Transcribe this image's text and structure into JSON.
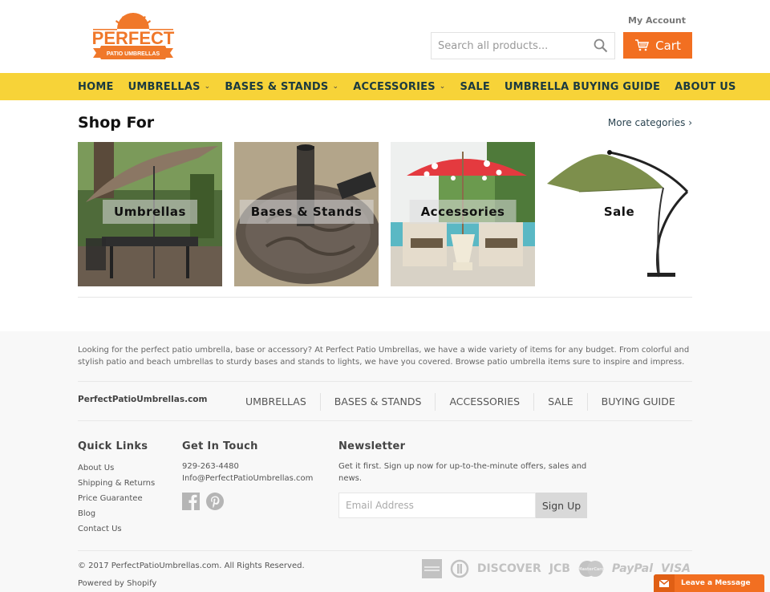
{
  "header": {
    "logo_text": "PERFECT",
    "logo_subtext": "PATIO UMBRELLAS",
    "my_account": "My Account",
    "search_placeholder": "Search all products...",
    "cart_label": "Cart"
  },
  "nav": {
    "items": [
      {
        "label": "HOME",
        "dropdown": false
      },
      {
        "label": "UMBRELLAS",
        "dropdown": true
      },
      {
        "label": "BASES & STANDS",
        "dropdown": true
      },
      {
        "label": "ACCESSORIES",
        "dropdown": true
      },
      {
        "label": "SALE",
        "dropdown": false
      },
      {
        "label": "UMBRELLA BUYING GUIDE",
        "dropdown": false
      },
      {
        "label": "ABOUT US",
        "dropdown": false
      }
    ],
    "chevron": "⌄"
  },
  "shop": {
    "title": "Shop For",
    "more_link": "More categories ›",
    "tiles": [
      {
        "label": "Umbrellas"
      },
      {
        "label": "Bases & Stands"
      },
      {
        "label": "Accessories"
      },
      {
        "label": "Sale"
      }
    ]
  },
  "footer": {
    "about": "Looking for the perfect patio umbrella, base or accessory? At Perfect Patio Umbrellas, we have a wide variety of items for any budget. From colorful and stylish patio and beach umbrellas to sturdy bases and stands to lights, we have you covered. Browse patio umbrella items sure to inspire and impress.",
    "site_name": "PerfectPatioUmbrellas.com",
    "links": [
      "UMBRELLAS",
      "BASES & STANDS",
      "ACCESSORIES",
      "SALE",
      "BUYING GUIDE"
    ],
    "quick_links": {
      "title": "Quick Links",
      "items": [
        "About Us",
        "Shipping & Returns",
        "Price Guarantee",
        "Blog",
        "Contact Us"
      ]
    },
    "get_in_touch": {
      "title": "Get In Touch",
      "phone": "929-263-4480",
      "email": "Info@PerfectPatioUmbrellas.com"
    },
    "newsletter": {
      "title": "Newsletter",
      "text": "Get it first. Sign up now for up-to-the-minute offers, sales and news.",
      "placeholder": "Email Address",
      "button": "Sign Up"
    },
    "copyright": "© 2017 PerfectPatioUmbrellas.com. All Rights Reserved.",
    "powered": "Powered by Shopify",
    "payments": [
      "American Express",
      "Diners Club",
      "DISCOVER",
      "JCB",
      "MasterCard",
      "PayPal",
      "VISA"
    ]
  },
  "chat": {
    "label": "Leave a Message"
  },
  "colors": {
    "accent": "#f26f21",
    "nav_bg": "#f7d338",
    "nav_text": "#1b3a40"
  }
}
